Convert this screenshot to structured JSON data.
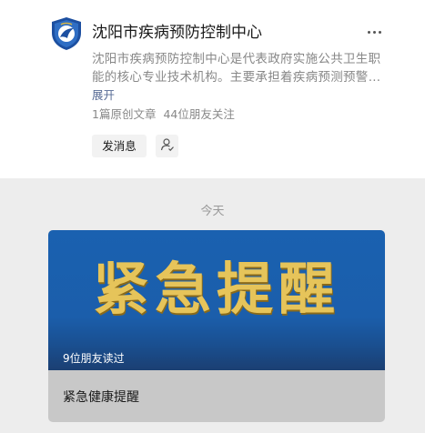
{
  "profile": {
    "name": "沈阳市疾病预防控制中心",
    "description": "沈阳市疾病预防控制中心是代表政府实施公共卫生职能的核心专业技术机构。主要承担着疾病预测预警…",
    "expand_label": "展开",
    "original_count": "1篇原创文章",
    "friends_following": "44位朋友关注",
    "send_message_label": "发消息",
    "logo_icon": "cdc-shield-logo",
    "more_icon": "more-dots-icon",
    "follow_icon": "person-check-icon"
  },
  "feed": {
    "date_label": "今天",
    "articles": [
      {
        "banner_text": "紧急提醒",
        "friends_read": "9位朋友读过",
        "title": "紧急健康提醒"
      }
    ]
  },
  "colors": {
    "link": "#576b95",
    "banner_blue": "#1a61b0",
    "banner_gold": "#e6c45a",
    "feed_bg": "#ededed"
  }
}
